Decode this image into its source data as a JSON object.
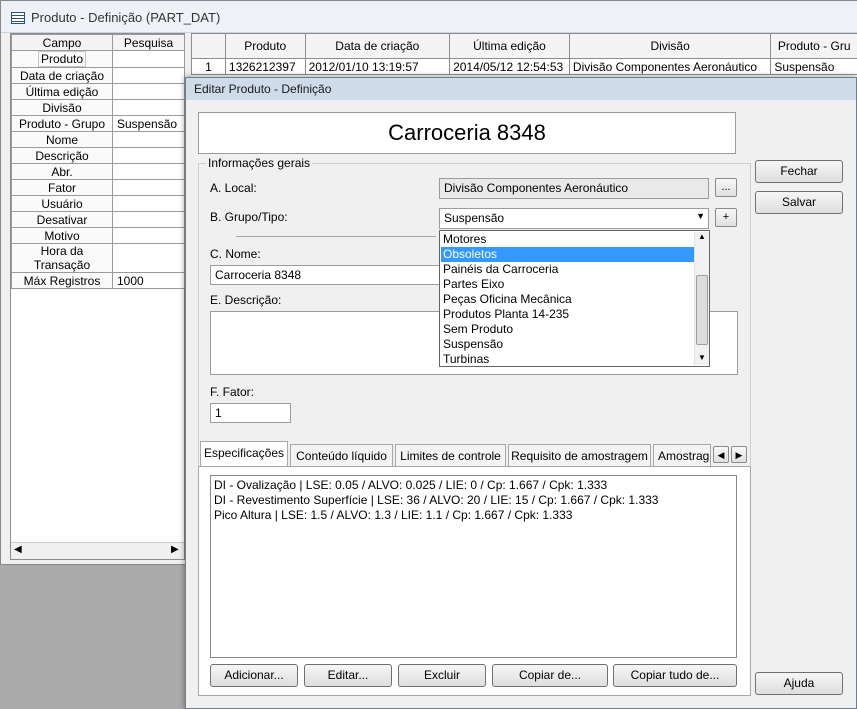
{
  "main_window": {
    "title": "Produto - Definição (PART_DAT)",
    "field_grid": {
      "headers": [
        "Campo",
        "Pesquisa"
      ],
      "rows": [
        {
          "field": "Produto",
          "value": ""
        },
        {
          "field": "Data de criação",
          "value": ""
        },
        {
          "field": "Última edição",
          "value": ""
        },
        {
          "field": "Divisão",
          "value": ""
        },
        {
          "field": "Produto - Grupo",
          "value": "Suspensão"
        },
        {
          "field": "Nome",
          "value": ""
        },
        {
          "field": "Descrição",
          "value": ""
        },
        {
          "field": "Abr.",
          "value": ""
        },
        {
          "field": "Fator",
          "value": ""
        },
        {
          "field": "Usuário",
          "value": ""
        },
        {
          "field": "Desativar",
          "value": ""
        },
        {
          "field": "Motivo",
          "value": ""
        },
        {
          "field": "Hora da Transação",
          "value": ""
        },
        {
          "field": "Máx Registros",
          "value": "1000"
        }
      ]
    },
    "results_grid": {
      "headers": [
        "",
        "Produto",
        "Data de criação",
        "Última edição",
        "Divisão",
        "Produto - Gru"
      ],
      "rows": [
        [
          "1",
          "1326212397",
          "2012/01/10 13:19:57",
          "2014/05/12 12:54:53",
          "Divisão Componentes Aeronáutico",
          "Suspensão"
        ]
      ]
    }
  },
  "dialog": {
    "title": "Editar Produto - Definição",
    "product_name": "Carroceria 8348",
    "buttons": {
      "close": "Fechar",
      "save": "Salvar",
      "help": "Ajuda"
    },
    "general_info": {
      "legend": "Informações gerais",
      "local_label": "A. Local:",
      "local_value": "Divisão Componentes Aeronáutico",
      "browse_label": "...",
      "group_label": "B. Grupo/Tipo:",
      "group_value": "Suspensão",
      "add_label": "+",
      "name_label": "C. Nome:",
      "name_value": "Carroceria 8348",
      "desc_label": "E. Descrição:",
      "desc_value": "",
      "factor_label": "F. Fator:",
      "factor_value": "1"
    },
    "dropdown_options": [
      "Motores",
      "Obsoletos",
      "Painéis da Carroceria",
      "Partes Eixo",
      "Peças Oficina Mecânica",
      "Produtos Planta 14-235",
      "Sem Produto",
      "Suspensão",
      "Turbinas"
    ],
    "dropdown_selected": "Obsoletos",
    "tabs": [
      "Especificações",
      "Conteúdo líquido",
      "Limites de controle",
      "Requisito de amostragem",
      "Amostrag"
    ],
    "active_tab": "Especificações",
    "spec_lines": [
      "DI - Ovalização | LSE: 0.05 / ALVO: 0.025 / LIE: 0 / Cp: 1.667 / Cpk: 1.333",
      "DI - Revestimento Superfície | LSE: 36 / ALVO: 20 / LIE: 15 / Cp: 1.667 / Cpk: 1.333",
      "Pico Altura | LSE: 1.5 / ALVO: 1.3 / LIE: 1.1 / Cp: 1.667 / Cpk: 1.333"
    ],
    "spec_buttons": [
      "Adicionar...",
      "Editar...",
      "Excluir",
      "Copiar de...",
      "Copiar tudo de..."
    ]
  }
}
